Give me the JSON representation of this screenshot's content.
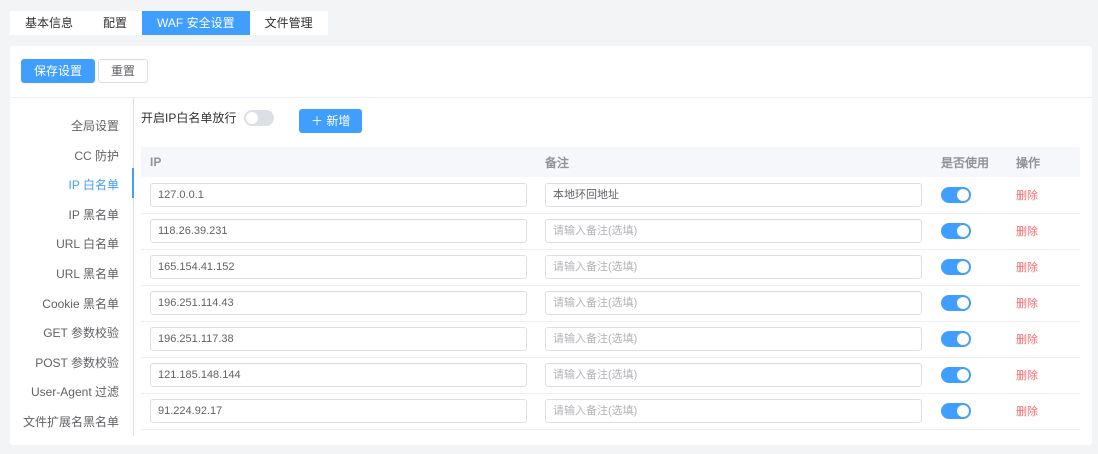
{
  "tabs": [
    "基本信息",
    "配置",
    "WAF 安全设置",
    "文件管理"
  ],
  "active_tab": 2,
  "toolbar": {
    "save": "保存设置",
    "reset": "重置"
  },
  "sidebar": [
    "全局设置",
    "CC 防护",
    "IP 白名单",
    "IP 黑名单",
    "URL 白名单",
    "URL 黑名单",
    "Cookie 黑名单",
    "GET 参数校验",
    "POST 参数校验",
    "User-Agent 过滤",
    "文件扩展名黑名单"
  ],
  "sidebar_active": 2,
  "whitelist": {
    "toggle_label": "开启IP白名单放行",
    "toggle_on": false,
    "add": "新增"
  },
  "columns": {
    "ip": "IP",
    "remark": "备注",
    "enabled": "是否使用",
    "action": "操作"
  },
  "remark_placeholder": "请输入备注(选填)",
  "delete_label": "删除",
  "rows": [
    {
      "ip": "127.0.0.1",
      "remark": "本地环回地址",
      "enabled": true
    },
    {
      "ip": "118.26.39.231",
      "remark": "",
      "enabled": true
    },
    {
      "ip": "165.154.41.152",
      "remark": "",
      "enabled": true
    },
    {
      "ip": "196.251.114.43",
      "remark": "",
      "enabled": true
    },
    {
      "ip": "196.251.117.38",
      "remark": "",
      "enabled": true
    },
    {
      "ip": "121.185.148.144",
      "remark": "",
      "enabled": true
    },
    {
      "ip": "91.224.92.17",
      "remark": "",
      "enabled": true
    }
  ]
}
